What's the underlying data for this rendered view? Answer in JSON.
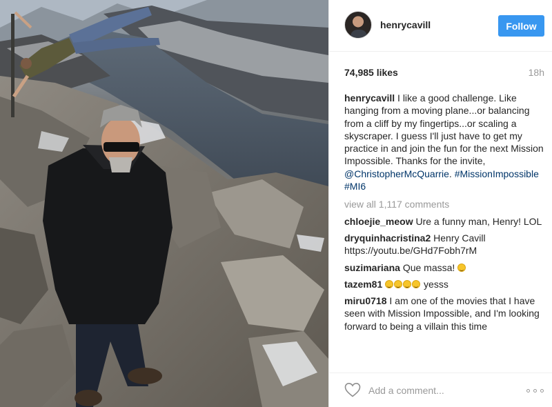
{
  "post": {
    "username": "henrycavill",
    "follow_label": "Follow",
    "likes": "74,985 likes",
    "time": "18h"
  },
  "caption": {
    "user": "henrycavill",
    "text": " I like a good challenge. Like hanging from a moving plane...or balancing from a cliff by my fingertips...or scaling a skyscraper. I guess I'll just have to get my practice in and join the fun for the next Mission Impossible. Thanks for the invite, ",
    "mention": "@ChristopherMcQuarrie",
    "tag1": "#MissionImpossible",
    "tag2": "#MI6"
  },
  "view_all": "view all 1,117 comments",
  "comments": [
    {
      "user": "chloejie_meow",
      "text": " Ure a funny man, Henry! LOL"
    },
    {
      "user": "dryquinhacristina2",
      "text": " Henry Cavill https://youtu.be/GHd7Fobh7rM"
    },
    {
      "user": "suzimariana",
      "text": " Que massa! "
    },
    {
      "user": "tazem81",
      "text": " yesss"
    },
    {
      "user": "miru0718",
      "text": " I am one of the movies that I have seen with Mission Impossible, and I'm looking forward to being a villain this time"
    }
  ],
  "footer": {
    "placeholder": "Add a comment...",
    "heart_icon": "heart-outline-icon",
    "more_icon": "more-options-icon"
  },
  "colors": {
    "follow": "#3897f0",
    "link": "#003569",
    "muted": "#999999"
  }
}
